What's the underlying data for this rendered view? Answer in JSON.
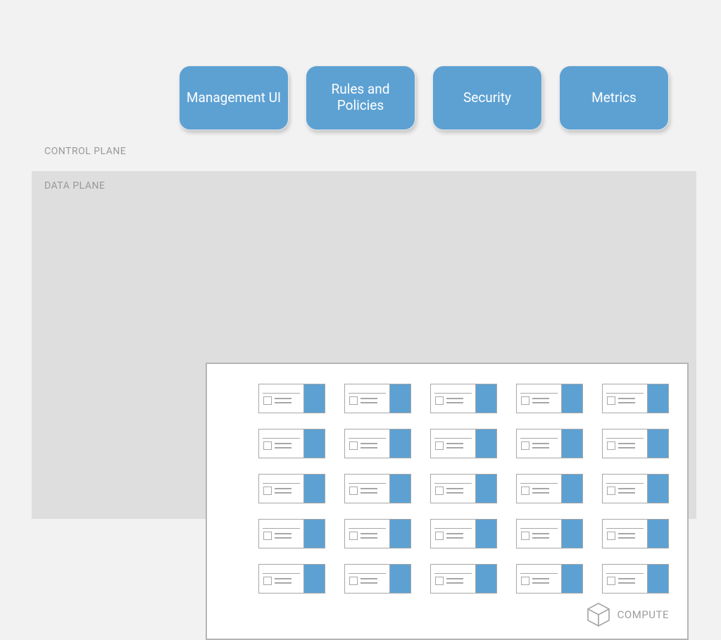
{
  "control_plane": {
    "label": "CONTROL PLANE",
    "blocks": [
      "Management UI",
      "Rules and Policies",
      "Security",
      "Metrics"
    ]
  },
  "data_plane": {
    "label": "DATA PLANE",
    "compute_label": "COMPUTE",
    "grid_rows": 5,
    "grid_cols": 5
  },
  "colors": {
    "accent": "#5da1d3",
    "panel_border": "#b5b5b5",
    "muted_text": "#9b9b9b"
  }
}
